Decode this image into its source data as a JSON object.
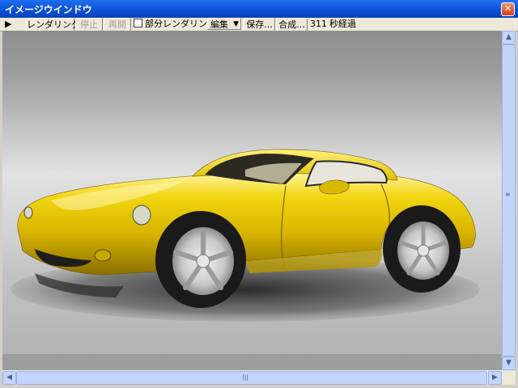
{
  "window": {
    "title": "イメージウインドウ",
    "close_label": "✕"
  },
  "toolbar": {
    "play_label": "▶",
    "render_label": "レンダリング",
    "stop_label": "停止",
    "resume_label": "再開",
    "partial_render_label": "部分レンダリング",
    "partial_render_checked": false,
    "edit_label": "編集",
    "edit_dropdown_label": "▼",
    "save_label": "保存...",
    "compose_label": "合成...",
    "elapsed_value": "311",
    "elapsed_label": "秒経過"
  },
  "scrollbar": {
    "up_arrow": "▲",
    "down_arrow": "▼",
    "left_arrow": "◀",
    "right_arrow": "▶",
    "grip": "≡",
    "hgrip": "|||"
  },
  "render_image": {
    "subject": "yellow sports car",
    "body_color": "#e8c800",
    "background_color": "#9a9a9a"
  }
}
